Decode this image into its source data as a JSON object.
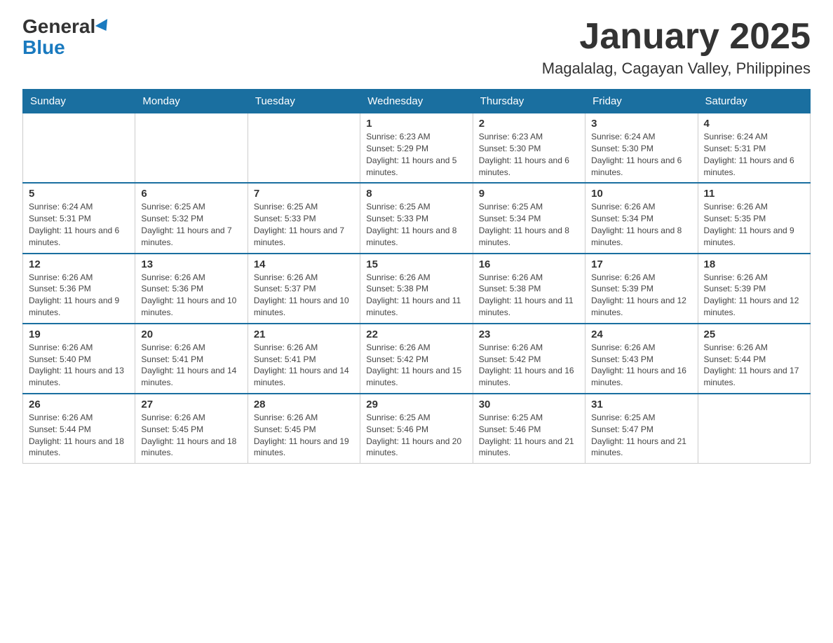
{
  "logo": {
    "general": "General",
    "blue": "Blue"
  },
  "title": {
    "month_year": "January 2025",
    "location": "Magalalag, Cagayan Valley, Philippines"
  },
  "headers": [
    "Sunday",
    "Monday",
    "Tuesday",
    "Wednesday",
    "Thursday",
    "Friday",
    "Saturday"
  ],
  "weeks": [
    [
      {
        "day": "",
        "info": ""
      },
      {
        "day": "",
        "info": ""
      },
      {
        "day": "",
        "info": ""
      },
      {
        "day": "1",
        "info": "Sunrise: 6:23 AM\nSunset: 5:29 PM\nDaylight: 11 hours and 5 minutes."
      },
      {
        "day": "2",
        "info": "Sunrise: 6:23 AM\nSunset: 5:30 PM\nDaylight: 11 hours and 6 minutes."
      },
      {
        "day": "3",
        "info": "Sunrise: 6:24 AM\nSunset: 5:30 PM\nDaylight: 11 hours and 6 minutes."
      },
      {
        "day": "4",
        "info": "Sunrise: 6:24 AM\nSunset: 5:31 PM\nDaylight: 11 hours and 6 minutes."
      }
    ],
    [
      {
        "day": "5",
        "info": "Sunrise: 6:24 AM\nSunset: 5:31 PM\nDaylight: 11 hours and 6 minutes."
      },
      {
        "day": "6",
        "info": "Sunrise: 6:25 AM\nSunset: 5:32 PM\nDaylight: 11 hours and 7 minutes."
      },
      {
        "day": "7",
        "info": "Sunrise: 6:25 AM\nSunset: 5:33 PM\nDaylight: 11 hours and 7 minutes."
      },
      {
        "day": "8",
        "info": "Sunrise: 6:25 AM\nSunset: 5:33 PM\nDaylight: 11 hours and 8 minutes."
      },
      {
        "day": "9",
        "info": "Sunrise: 6:25 AM\nSunset: 5:34 PM\nDaylight: 11 hours and 8 minutes."
      },
      {
        "day": "10",
        "info": "Sunrise: 6:26 AM\nSunset: 5:34 PM\nDaylight: 11 hours and 8 minutes."
      },
      {
        "day": "11",
        "info": "Sunrise: 6:26 AM\nSunset: 5:35 PM\nDaylight: 11 hours and 9 minutes."
      }
    ],
    [
      {
        "day": "12",
        "info": "Sunrise: 6:26 AM\nSunset: 5:36 PM\nDaylight: 11 hours and 9 minutes."
      },
      {
        "day": "13",
        "info": "Sunrise: 6:26 AM\nSunset: 5:36 PM\nDaylight: 11 hours and 10 minutes."
      },
      {
        "day": "14",
        "info": "Sunrise: 6:26 AM\nSunset: 5:37 PM\nDaylight: 11 hours and 10 minutes."
      },
      {
        "day": "15",
        "info": "Sunrise: 6:26 AM\nSunset: 5:38 PM\nDaylight: 11 hours and 11 minutes."
      },
      {
        "day": "16",
        "info": "Sunrise: 6:26 AM\nSunset: 5:38 PM\nDaylight: 11 hours and 11 minutes."
      },
      {
        "day": "17",
        "info": "Sunrise: 6:26 AM\nSunset: 5:39 PM\nDaylight: 11 hours and 12 minutes."
      },
      {
        "day": "18",
        "info": "Sunrise: 6:26 AM\nSunset: 5:39 PM\nDaylight: 11 hours and 12 minutes."
      }
    ],
    [
      {
        "day": "19",
        "info": "Sunrise: 6:26 AM\nSunset: 5:40 PM\nDaylight: 11 hours and 13 minutes."
      },
      {
        "day": "20",
        "info": "Sunrise: 6:26 AM\nSunset: 5:41 PM\nDaylight: 11 hours and 14 minutes."
      },
      {
        "day": "21",
        "info": "Sunrise: 6:26 AM\nSunset: 5:41 PM\nDaylight: 11 hours and 14 minutes."
      },
      {
        "day": "22",
        "info": "Sunrise: 6:26 AM\nSunset: 5:42 PM\nDaylight: 11 hours and 15 minutes."
      },
      {
        "day": "23",
        "info": "Sunrise: 6:26 AM\nSunset: 5:42 PM\nDaylight: 11 hours and 16 minutes."
      },
      {
        "day": "24",
        "info": "Sunrise: 6:26 AM\nSunset: 5:43 PM\nDaylight: 11 hours and 16 minutes."
      },
      {
        "day": "25",
        "info": "Sunrise: 6:26 AM\nSunset: 5:44 PM\nDaylight: 11 hours and 17 minutes."
      }
    ],
    [
      {
        "day": "26",
        "info": "Sunrise: 6:26 AM\nSunset: 5:44 PM\nDaylight: 11 hours and 18 minutes."
      },
      {
        "day": "27",
        "info": "Sunrise: 6:26 AM\nSunset: 5:45 PM\nDaylight: 11 hours and 18 minutes."
      },
      {
        "day": "28",
        "info": "Sunrise: 6:26 AM\nSunset: 5:45 PM\nDaylight: 11 hours and 19 minutes."
      },
      {
        "day": "29",
        "info": "Sunrise: 6:25 AM\nSunset: 5:46 PM\nDaylight: 11 hours and 20 minutes."
      },
      {
        "day": "30",
        "info": "Sunrise: 6:25 AM\nSunset: 5:46 PM\nDaylight: 11 hours and 21 minutes."
      },
      {
        "day": "31",
        "info": "Sunrise: 6:25 AM\nSunset: 5:47 PM\nDaylight: 11 hours and 21 minutes."
      },
      {
        "day": "",
        "info": ""
      }
    ]
  ]
}
